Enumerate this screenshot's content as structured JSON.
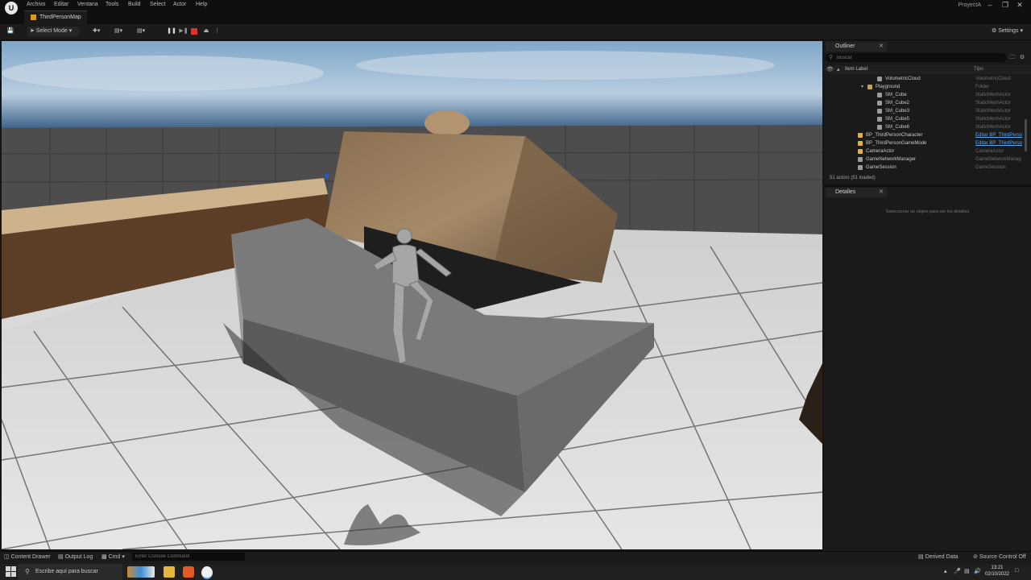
{
  "menubar": {
    "items": [
      "Archivo",
      "Editar",
      "Ventana",
      "Tools",
      "Build",
      "Select",
      "Actor",
      "Help"
    ],
    "project_name": "ProyectA",
    "window_controls": [
      "minimize-icon",
      "restore-icon",
      "close-icon"
    ]
  },
  "tab": {
    "label": "ThirdPersonMap"
  },
  "toolbar": {
    "select_mode_label": "Select Mode",
    "settings_label": "Settings",
    "play_controls": [
      "pause-icon",
      "step-icon",
      "stop-icon",
      "eject-icon"
    ]
  },
  "outliner": {
    "tab_label": "Outliner",
    "search_placeholder": "Buscar",
    "col_label": "Item Label",
    "col_type": "Tipo",
    "rows": [
      {
        "label": "VolumetricCloud",
        "type": "VolumetricCloud",
        "indent": 3,
        "icon": "cloud-icon",
        "link": false
      },
      {
        "label": "Playground",
        "type": "Folder",
        "indent": 2,
        "icon": "folder-icon",
        "link": false
      },
      {
        "label": "SM_Cube",
        "type": "StaticMeshActor",
        "indent": 3,
        "icon": "mesh-icon",
        "link": false
      },
      {
        "label": "SM_Cube2",
        "type": "StaticMeshActor",
        "indent": 3,
        "icon": "mesh-icon",
        "link": false
      },
      {
        "label": "SM_Cube3",
        "type": "StaticMeshActor",
        "indent": 3,
        "icon": "mesh-icon",
        "link": false
      },
      {
        "label": "SM_Cube5",
        "type": "StaticMeshActor",
        "indent": 3,
        "icon": "mesh-icon",
        "link": false
      },
      {
        "label": "SM_Cube6",
        "type": "StaticMeshActor",
        "indent": 3,
        "icon": "mesh-icon",
        "link": false
      },
      {
        "label": "BP_ThirdPersonCharacter",
        "type": "Editar BP_ThirdPerso",
        "indent": 1,
        "icon": "pawn-icon",
        "link": true
      },
      {
        "label": "BP_ThirdPersonGameMode",
        "type": "Editar BP_ThirdPerso",
        "indent": 1,
        "icon": "gamemode-icon",
        "link": true
      },
      {
        "label": "CameraActor",
        "type": "CameraActor",
        "indent": 1,
        "icon": "camera-icon",
        "link": false
      },
      {
        "label": "GameNetworkManager",
        "type": "GameNetworkManag",
        "indent": 1,
        "icon": "actor-icon",
        "link": false
      },
      {
        "label": "GameSession",
        "type": "GameSession",
        "indent": 1,
        "icon": "actor-icon",
        "link": false
      }
    ],
    "actor_count": "51 actors (51 loaded)"
  },
  "details": {
    "tab_label": "Detalles",
    "hint": "Seleccionar un objeto para ver los detalles"
  },
  "statusbar": {
    "content_drawer": "Content Drawer",
    "output_log": "Output Log",
    "cmd": "Cmd",
    "console_placeholder": "Enter Console Command",
    "derived_data": "Derived Data",
    "source_control": "Source Control Off"
  },
  "taskbar": {
    "search_text": "Escribe aquí para buscar",
    "time": "13:21",
    "date": "02/10/2022"
  }
}
